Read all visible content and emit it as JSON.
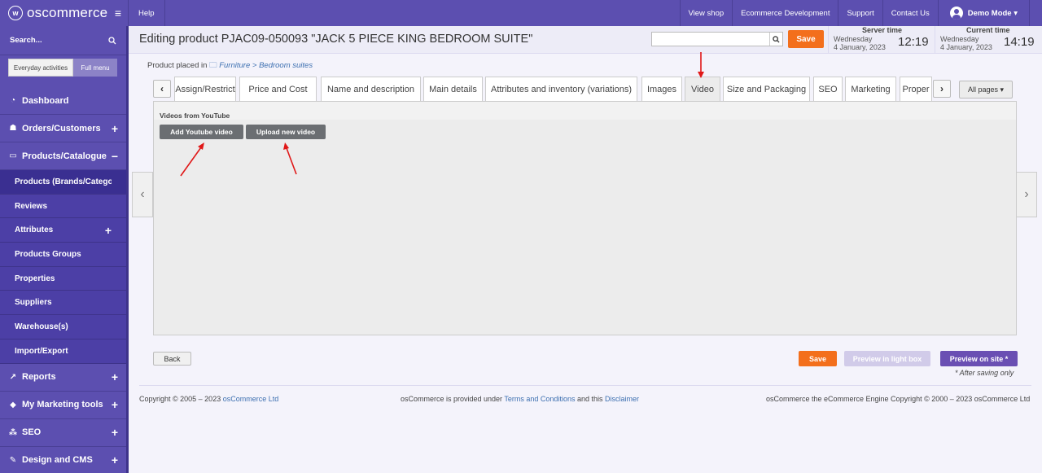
{
  "topbar": {
    "logo": "oscommerce",
    "help": "Help",
    "links": [
      "View shop",
      "Ecommerce Development",
      "Support",
      "Contact Us"
    ],
    "user": "Demo Mode ▾"
  },
  "sidebar": {
    "search_label": "Search...",
    "switch_a": "Everyday activities",
    "switch_b": "Full menu",
    "dashboard": "Dashboard",
    "orders": "Orders/Customers",
    "products": "Products/Catalogue",
    "sub": [
      "Products (Brands/Catego...",
      "Reviews",
      "Attributes",
      "Products Groups",
      "Properties",
      "Suppliers",
      "Warehouse(s)",
      "Import/Export"
    ],
    "reports": "Reports",
    "marketing": "My Marketing tools",
    "seo": "SEO",
    "design": "Design and CMS"
  },
  "header": {
    "title": "Editing product PJAC09-050093 \"JACK 5 PIECE KING BEDROOM SUITE\"",
    "search_value": "",
    "save": "Save",
    "server_time_label": "Server time",
    "server_date_day": "Wednesday",
    "server_date": "4 January, 2023",
    "server_clock": "12:19",
    "current_time_label": "Current time",
    "current_date_day": "Wednesday",
    "current_date": "4 January, 2023",
    "current_clock": "14:19"
  },
  "breadcrumb": {
    "label": "Product placed in",
    "category": "Furniture",
    "sep": ">",
    "subcategory": "Bedroom suites"
  },
  "tabs": [
    "Assign/Restrict",
    "Price and Cost",
    "Name and description",
    "Main details",
    "Attributes and inventory (variations)",
    "Images",
    "Video",
    "Size and Packaging",
    "SEO",
    "Marketing",
    "Proper"
  ],
  "active_tab": "Video",
  "all_pages": "All pages ▾",
  "panel": {
    "title": "Videos from YouTube",
    "add_youtube": "Add Youtube video",
    "upload": "Upload new video"
  },
  "actions": {
    "back": "Back",
    "save": "Save",
    "preview_lightbox": "Preview in light box",
    "preview_site": "Preview on site *",
    "note": "* After saving only"
  },
  "footer": {
    "copyright": "Copyright © 2005 – 2023",
    "copyright_link": "osCommerce Ltd",
    "provided": "osCommerce is provided under",
    "terms": "Terms and Conditions",
    "and_this": "and this",
    "disclaimer": "Disclaimer",
    "engine": "osCommerce the eCommerce Engine Copyright © 2000 – 2023 osCommerce Ltd"
  },
  "colors": {
    "brand": "#5c4fb0",
    "save_orange": "#f36f1c",
    "preview_purple": "#6a4fb3",
    "annotation_red": "#e01818"
  }
}
